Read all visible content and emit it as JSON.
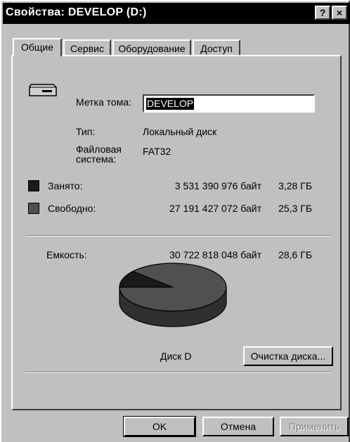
{
  "window": {
    "title": "Свойства: DEVELOP (D:)",
    "help_label": "?",
    "close_label": "×"
  },
  "tabs": [
    "Общие",
    "Сервис",
    "Оборудование",
    "Доступ"
  ],
  "general": {
    "volume_label_caption": "Метка тома:",
    "volume_label_value": "DEVELOP",
    "type_caption": "Тип:",
    "type_value": "Локальный диск",
    "fs_caption_line1": "Файловая",
    "fs_caption_line2": "система:",
    "fs_value": "FAT32",
    "used_caption": "Занято:",
    "used_bytes": "3 531 390 976 байт",
    "used_gb": "3,28 ГБ",
    "free_caption": "Свободно:",
    "free_bytes": "27 191 427 072 байт",
    "free_gb": "25,3 ГБ",
    "capacity_caption": "Емкость:",
    "capacity_bytes": "30 722 818 048 байт",
    "capacity_gb": "28,6 ГБ",
    "disk_label": "Диск D",
    "cleanup_button": "Очистка диска...",
    "used_color": "#1a1a1a",
    "free_color": "#505050"
  },
  "buttons": {
    "ok": "OK",
    "cancel": "Отмена",
    "apply": "Применить"
  },
  "chart_data": {
    "type": "pie",
    "slices": [
      {
        "name": "Занято",
        "value": 3.28,
        "color": "#1a1a1a"
      },
      {
        "name": "Свободно",
        "value": 25.3,
        "color": "#505050"
      }
    ],
    "title": "Диск D"
  }
}
